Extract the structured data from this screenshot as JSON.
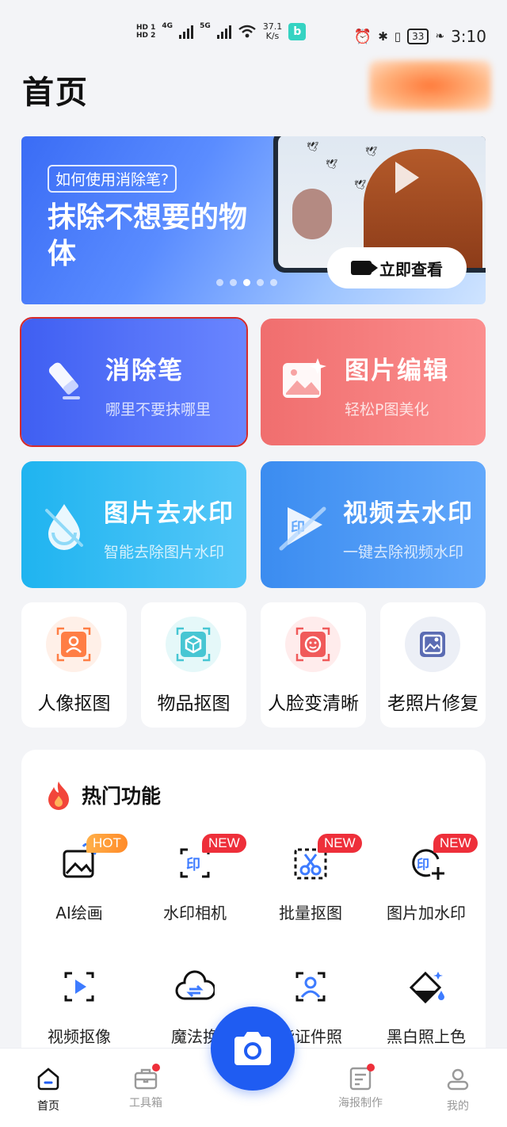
{
  "status_bar": {
    "hd1": "HD 1",
    "hd2": "HD 2",
    "net1": "4G",
    "net2": "5G",
    "speed_value": "37.1",
    "speed_unit": "K/s",
    "app_badge": "b",
    "battery": "33",
    "time": "3:10"
  },
  "header": {
    "title": "首页"
  },
  "banner": {
    "question": "如何使用消除笔?",
    "headline": "抹除不想要的物体",
    "cta": "立即查看",
    "dots_count": 5,
    "active_dot": 2
  },
  "features": {
    "eraser": {
      "title": "消除笔",
      "subtitle": "哪里不要抹哪里"
    },
    "edit": {
      "title": "图片编辑",
      "subtitle": "轻松P图美化"
    },
    "wm_image": {
      "title": "图片去水印",
      "subtitle": "智能去除图片水印"
    },
    "wm_video": {
      "title": "视频去水印",
      "subtitle": "一键去除视频水印"
    }
  },
  "small_tools": [
    {
      "label": "人像抠图"
    },
    {
      "label": "物品抠图"
    },
    {
      "label": "人脸变清晰"
    },
    {
      "label": "老照片修复"
    }
  ],
  "hot": {
    "title": "热门功能",
    "items": [
      {
        "label": "AI绘画",
        "badge": "HOT"
      },
      {
        "label": "水印相机",
        "badge": "NEW"
      },
      {
        "label": "批量抠图",
        "badge": "NEW"
      },
      {
        "label": "图片加水印",
        "badge": "NEW"
      },
      {
        "label": "视频抠像",
        "badge": ""
      },
      {
        "label": "魔法换",
        "badge": ""
      },
      {
        "label": "能证件照",
        "badge": ""
      },
      {
        "label": "黑白照上色",
        "badge": ""
      }
    ]
  },
  "bottom_nav": {
    "home": "首页",
    "toolbox": "工具箱",
    "poster": "海报制作",
    "mine": "我的"
  },
  "colors": {
    "primary": "#1f5cf2",
    "badge_new": "#ee2f3a",
    "badge_hot": "#ff8a28",
    "eraser_tile": "#3f5ff2",
    "edit_tile": "#f06e6e",
    "wm_image_tile": "#1fb4f0",
    "wm_video_tile": "#3b8cf0"
  }
}
